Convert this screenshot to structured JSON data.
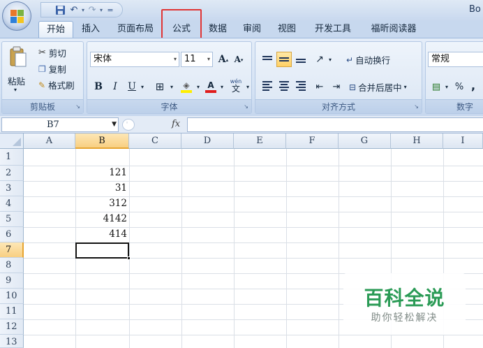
{
  "window": {
    "title_partial": "Bo"
  },
  "quick_access": {
    "customize": "="
  },
  "tabs": [
    {
      "label": "开始",
      "active": true
    },
    {
      "label": "插入"
    },
    {
      "label": "页面布局"
    },
    {
      "label": "公式",
      "highlighted": true
    },
    {
      "label": "数据"
    },
    {
      "label": "审阅"
    },
    {
      "label": "视图"
    },
    {
      "label": "开发工具"
    },
    {
      "label": "福昕阅读器"
    }
  ],
  "clipboard": {
    "paste": "粘贴",
    "cut": "剪切",
    "copy": "复制",
    "format_painter": "格式刷",
    "group_label": "剪贴板"
  },
  "font": {
    "name": "宋体",
    "size": "11",
    "bold": "B",
    "italic": "I",
    "underline": "U",
    "phonetic": "wén",
    "group_label": "字体"
  },
  "alignment": {
    "wrap_text": "自动换行",
    "merge_center": "合并后居中",
    "group_label": "对齐方式"
  },
  "number": {
    "format": "常规",
    "percent": "%",
    "comma": ",",
    "group_label": "数字"
  },
  "formula_bar": {
    "name_box": "B7",
    "fx": "fx",
    "content": ""
  },
  "columns": [
    "A",
    "B",
    "C",
    "D",
    "E",
    "F",
    "G",
    "H",
    "I"
  ],
  "selected_column": "B",
  "rows": [
    "1",
    "2",
    "3",
    "4",
    "5",
    "6",
    "7",
    "8",
    "9",
    "10",
    "11",
    "12",
    "13"
  ],
  "selected_row": "7",
  "cells": {
    "B2": "121",
    "B3": "31",
    "B4": "312",
    "B5": "4142",
    "B6": "414"
  },
  "watermark": {
    "title": "百科全说",
    "subtitle": "助你轻松解决"
  },
  "colors": {
    "tab_highlight_border": "#e03434",
    "selection": "#f8cf82",
    "watermark_green": "#2b9b56"
  }
}
